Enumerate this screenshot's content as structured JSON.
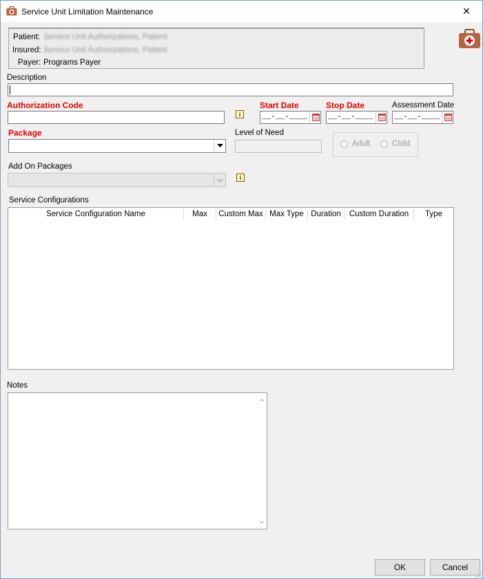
{
  "window": {
    "title": "Service Unit Limitation Maintenance",
    "close_glyph": "✕"
  },
  "info": {
    "patient_label": "Patient:",
    "patient_value": "Service Unit Authorizations, Patient",
    "insured_label": "Insured:",
    "insured_value": "Service Unit Authorizations, Patient",
    "payer_label": "Payer:",
    "payer_value": "Programs Payer"
  },
  "form": {
    "description_label": "Description",
    "description_value": "",
    "auth_code_label": "Authorization Code",
    "auth_code_value": "",
    "start_date_label": "Start Date",
    "start_date_value": "__-__-____",
    "stop_date_label": "Stop Date",
    "stop_date_value": "__-__-____",
    "assessment_date_label": "Assessment Date",
    "assessment_date_value": "__-__-____",
    "package_label": "Package",
    "package_value": "",
    "level_of_need_label": "Level of Need",
    "level_of_need_value": "",
    "adult_label": "Adult",
    "child_label": "Child",
    "add_on_label": "Add On Packages",
    "info_glyph": "i"
  },
  "service_configurations": {
    "label": "Service Configurations",
    "columns": [
      "Service Configuration Name",
      "Max",
      "Custom Max",
      "Max Type",
      "Duration",
      "Custom Duration",
      "Type"
    ],
    "rows": []
  },
  "notes": {
    "label": "Notes",
    "value": ""
  },
  "buttons": {
    "ok": "OK",
    "cancel": "Cancel"
  },
  "icons": {
    "app": "medical-kit-icon",
    "brand_color": "#b5643f",
    "required_color": "#e00000"
  }
}
